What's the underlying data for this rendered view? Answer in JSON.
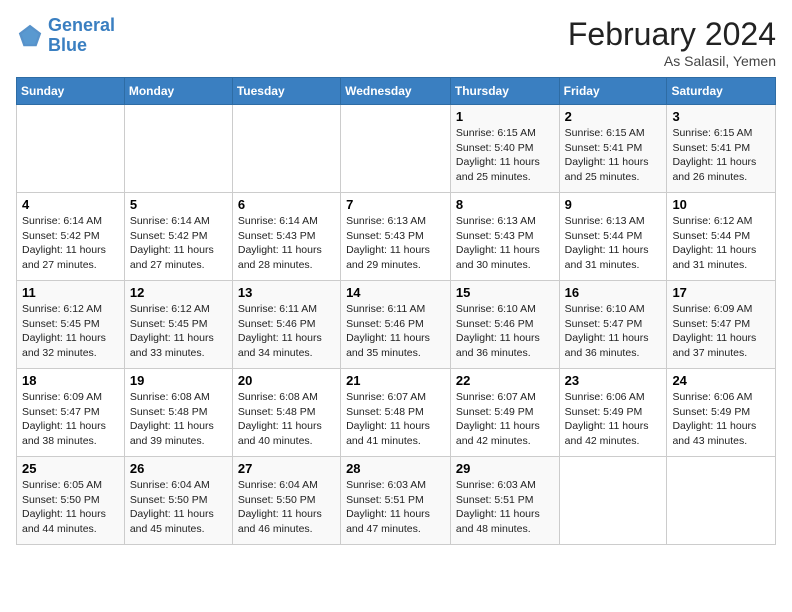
{
  "header": {
    "logo_line1": "General",
    "logo_line2": "Blue",
    "month_title": "February 2024",
    "location": "As Salasil, Yemen"
  },
  "days_of_week": [
    "Sunday",
    "Monday",
    "Tuesday",
    "Wednesday",
    "Thursday",
    "Friday",
    "Saturday"
  ],
  "weeks": [
    [
      {
        "day": "",
        "info": ""
      },
      {
        "day": "",
        "info": ""
      },
      {
        "day": "",
        "info": ""
      },
      {
        "day": "",
        "info": ""
      },
      {
        "day": "1",
        "info": "Sunrise: 6:15 AM\nSunset: 5:40 PM\nDaylight: 11 hours and 25 minutes."
      },
      {
        "day": "2",
        "info": "Sunrise: 6:15 AM\nSunset: 5:41 PM\nDaylight: 11 hours and 25 minutes."
      },
      {
        "day": "3",
        "info": "Sunrise: 6:15 AM\nSunset: 5:41 PM\nDaylight: 11 hours and 26 minutes."
      }
    ],
    [
      {
        "day": "4",
        "info": "Sunrise: 6:14 AM\nSunset: 5:42 PM\nDaylight: 11 hours and 27 minutes."
      },
      {
        "day": "5",
        "info": "Sunrise: 6:14 AM\nSunset: 5:42 PM\nDaylight: 11 hours and 27 minutes."
      },
      {
        "day": "6",
        "info": "Sunrise: 6:14 AM\nSunset: 5:43 PM\nDaylight: 11 hours and 28 minutes."
      },
      {
        "day": "7",
        "info": "Sunrise: 6:13 AM\nSunset: 5:43 PM\nDaylight: 11 hours and 29 minutes."
      },
      {
        "day": "8",
        "info": "Sunrise: 6:13 AM\nSunset: 5:43 PM\nDaylight: 11 hours and 30 minutes."
      },
      {
        "day": "9",
        "info": "Sunrise: 6:13 AM\nSunset: 5:44 PM\nDaylight: 11 hours and 31 minutes."
      },
      {
        "day": "10",
        "info": "Sunrise: 6:12 AM\nSunset: 5:44 PM\nDaylight: 11 hours and 31 minutes."
      }
    ],
    [
      {
        "day": "11",
        "info": "Sunrise: 6:12 AM\nSunset: 5:45 PM\nDaylight: 11 hours and 32 minutes."
      },
      {
        "day": "12",
        "info": "Sunrise: 6:12 AM\nSunset: 5:45 PM\nDaylight: 11 hours and 33 minutes."
      },
      {
        "day": "13",
        "info": "Sunrise: 6:11 AM\nSunset: 5:46 PM\nDaylight: 11 hours and 34 minutes."
      },
      {
        "day": "14",
        "info": "Sunrise: 6:11 AM\nSunset: 5:46 PM\nDaylight: 11 hours and 35 minutes."
      },
      {
        "day": "15",
        "info": "Sunrise: 6:10 AM\nSunset: 5:46 PM\nDaylight: 11 hours and 36 minutes."
      },
      {
        "day": "16",
        "info": "Sunrise: 6:10 AM\nSunset: 5:47 PM\nDaylight: 11 hours and 36 minutes."
      },
      {
        "day": "17",
        "info": "Sunrise: 6:09 AM\nSunset: 5:47 PM\nDaylight: 11 hours and 37 minutes."
      }
    ],
    [
      {
        "day": "18",
        "info": "Sunrise: 6:09 AM\nSunset: 5:47 PM\nDaylight: 11 hours and 38 minutes."
      },
      {
        "day": "19",
        "info": "Sunrise: 6:08 AM\nSunset: 5:48 PM\nDaylight: 11 hours and 39 minutes."
      },
      {
        "day": "20",
        "info": "Sunrise: 6:08 AM\nSunset: 5:48 PM\nDaylight: 11 hours and 40 minutes."
      },
      {
        "day": "21",
        "info": "Sunrise: 6:07 AM\nSunset: 5:48 PM\nDaylight: 11 hours and 41 minutes."
      },
      {
        "day": "22",
        "info": "Sunrise: 6:07 AM\nSunset: 5:49 PM\nDaylight: 11 hours and 42 minutes."
      },
      {
        "day": "23",
        "info": "Sunrise: 6:06 AM\nSunset: 5:49 PM\nDaylight: 11 hours and 42 minutes."
      },
      {
        "day": "24",
        "info": "Sunrise: 6:06 AM\nSunset: 5:49 PM\nDaylight: 11 hours and 43 minutes."
      }
    ],
    [
      {
        "day": "25",
        "info": "Sunrise: 6:05 AM\nSunset: 5:50 PM\nDaylight: 11 hours and 44 minutes."
      },
      {
        "day": "26",
        "info": "Sunrise: 6:04 AM\nSunset: 5:50 PM\nDaylight: 11 hours and 45 minutes."
      },
      {
        "day": "27",
        "info": "Sunrise: 6:04 AM\nSunset: 5:50 PM\nDaylight: 11 hours and 46 minutes."
      },
      {
        "day": "28",
        "info": "Sunrise: 6:03 AM\nSunset: 5:51 PM\nDaylight: 11 hours and 47 minutes."
      },
      {
        "day": "29",
        "info": "Sunrise: 6:03 AM\nSunset: 5:51 PM\nDaylight: 11 hours and 48 minutes."
      },
      {
        "day": "",
        "info": ""
      },
      {
        "day": "",
        "info": ""
      }
    ]
  ]
}
